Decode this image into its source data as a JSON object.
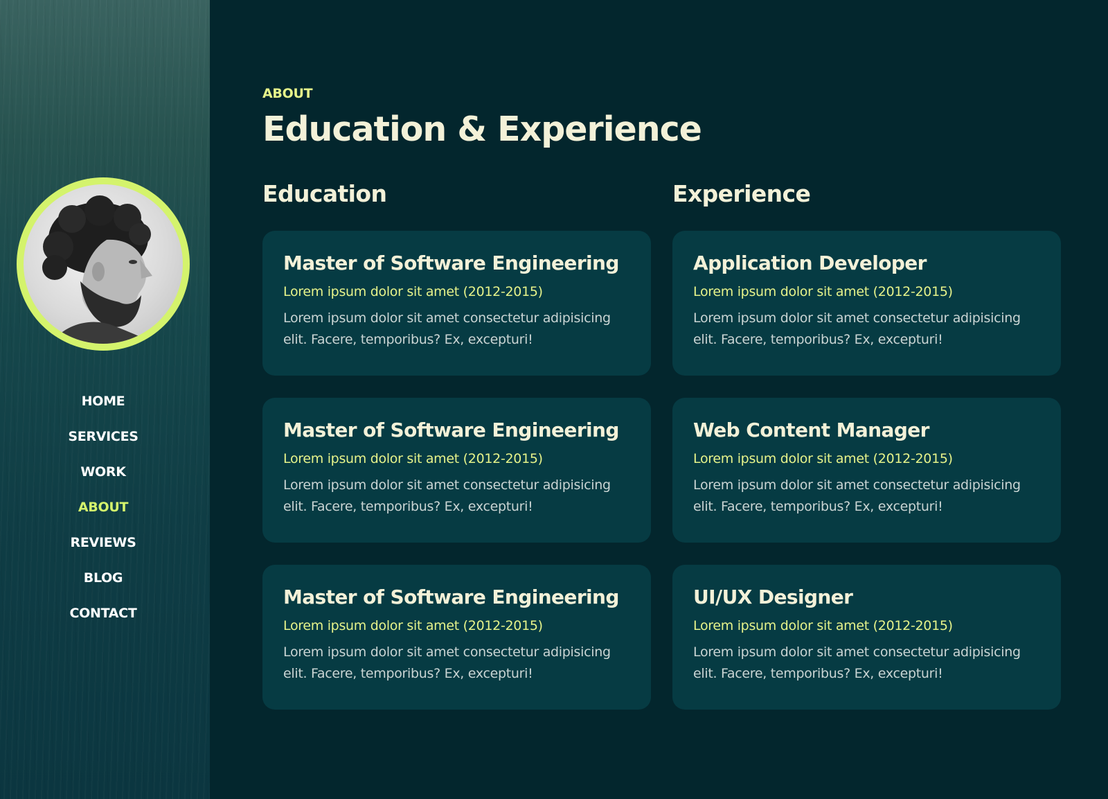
{
  "sidebar": {
    "nav": [
      {
        "label": "HOME",
        "active": false
      },
      {
        "label": "SERVICES",
        "active": false
      },
      {
        "label": "WORK",
        "active": false
      },
      {
        "label": "ABOUT",
        "active": true
      },
      {
        "label": "REVIEWS",
        "active": false
      },
      {
        "label": "BLOG",
        "active": false
      },
      {
        "label": "CONTACT",
        "active": false
      }
    ]
  },
  "main": {
    "eyebrow": "ABOUT",
    "title": "Education & Experience",
    "education": {
      "heading": "Education",
      "items": [
        {
          "title": "Master of Software Engineering",
          "subtitle": "Lorem ipsum dolor sit amet (2012-2015)",
          "description": "Lorem ipsum dolor sit amet consectetur adipisicing elit. Facere, temporibus? Ex, excepturi!"
        },
        {
          "title": "Master of Software Engineering",
          "subtitle": "Lorem ipsum dolor sit amet (2012-2015)",
          "description": "Lorem ipsum dolor sit amet consectetur adipisicing elit. Facere, temporibus? Ex, excepturi!"
        },
        {
          "title": "Master of Software Engineering",
          "subtitle": "Lorem ipsum dolor sit amet (2012-2015)",
          "description": "Lorem ipsum dolor sit amet consectetur adipisicing elit. Facere, temporibus? Ex, excepturi!"
        }
      ]
    },
    "experience": {
      "heading": "Experience",
      "items": [
        {
          "title": "Application Developer",
          "subtitle": "Lorem ipsum dolor sit amet (2012-2015)",
          "description": "Lorem ipsum dolor sit amet consectetur adipisicing elit. Facere, temporibus? Ex, excepturi!"
        },
        {
          "title": "Web Content Manager",
          "subtitle": "Lorem ipsum dolor sit amet (2012-2015)",
          "description": "Lorem ipsum dolor sit amet consectetur adipisicing elit. Facere, temporibus? Ex, excepturi!"
        },
        {
          "title": "UI/UX Designer",
          "subtitle": "Lorem ipsum dolor sit amet (2012-2015)",
          "description": "Lorem ipsum dolor sit amet consectetur adipisicing elit. Facere, temporibus? Ex, excepturi!"
        }
      ]
    }
  },
  "colors": {
    "accent": "#d4f36c",
    "background": "#03262d",
    "card": "#063b43",
    "heading": "#f3f1d8"
  },
  "icons": {
    "avatar": "bearded-man-profile-photo"
  }
}
